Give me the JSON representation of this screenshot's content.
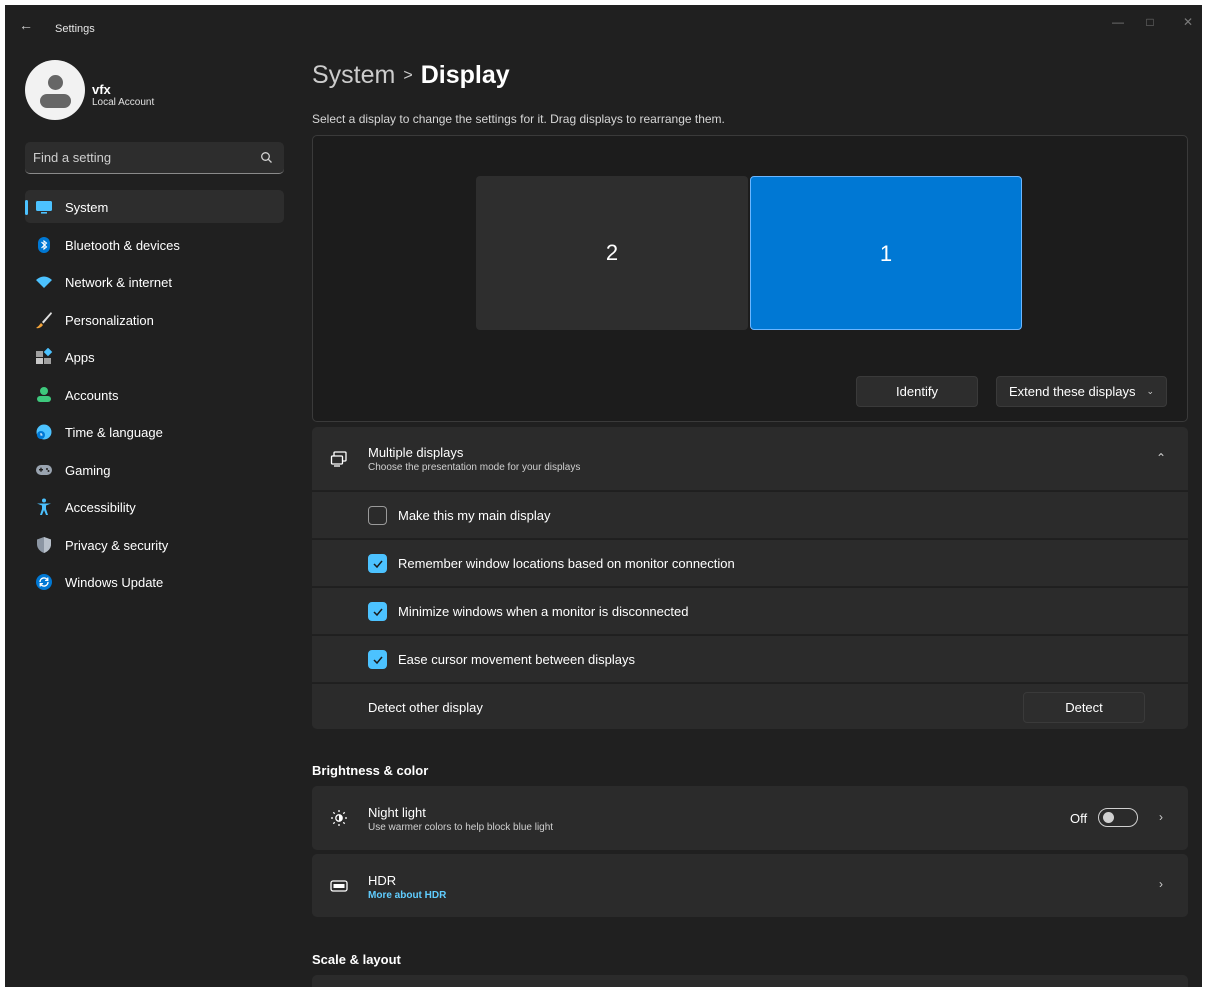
{
  "window": {
    "title": "Settings",
    "back_icon": "arrow-left-icon",
    "controls": [
      "minimize-icon",
      "maximize-icon",
      "close-icon"
    ]
  },
  "user": {
    "name": "vfx",
    "account_type": "Local Account"
  },
  "search": {
    "placeholder": "Find a setting",
    "value": ""
  },
  "sidebar": {
    "items": [
      {
        "label": "System",
        "icon": "monitor-icon",
        "selected": true
      },
      {
        "label": "Bluetooth & devices",
        "icon": "bluetooth-icon",
        "selected": false
      },
      {
        "label": "Network & internet",
        "icon": "wifi-icon",
        "selected": false
      },
      {
        "label": "Personalization",
        "icon": "brush-icon",
        "selected": false
      },
      {
        "label": "Apps",
        "icon": "apps-icon",
        "selected": false
      },
      {
        "label": "Accounts",
        "icon": "person-icon",
        "selected": false
      },
      {
        "label": "Time & language",
        "icon": "globe-clock-icon",
        "selected": false
      },
      {
        "label": "Gaming",
        "icon": "gamepad-icon",
        "selected": false
      },
      {
        "label": "Accessibility",
        "icon": "accessibility-icon",
        "selected": false
      },
      {
        "label": "Privacy & security",
        "icon": "shield-icon",
        "selected": false
      },
      {
        "label": "Windows Update",
        "icon": "refresh-icon",
        "selected": false
      }
    ]
  },
  "breadcrumb": {
    "parent": "System",
    "separator": ">",
    "current": "Display"
  },
  "display_arrangement": {
    "hint": "Select a display to change the settings for it. Drag displays to rearrange them.",
    "monitors": [
      {
        "number": "2",
        "selected": false
      },
      {
        "number": "1",
        "selected": true
      }
    ],
    "identify_label": "Identify",
    "extend_label": "Extend these displays"
  },
  "multiple_displays": {
    "title": "Multiple displays",
    "subtitle": "Choose the presentation mode for your displays",
    "expanded": true,
    "options": [
      {
        "label": "Make this my main display",
        "checked": false
      },
      {
        "label": "Remember window locations based on monitor connection",
        "checked": true
      },
      {
        "label": "Minimize windows when a monitor is disconnected",
        "checked": true
      },
      {
        "label": "Ease cursor movement between displays",
        "checked": true
      }
    ],
    "detect_label": "Detect other display",
    "detect_button": "Detect"
  },
  "brightness_color": {
    "section_title": "Brightness & color",
    "night_light": {
      "title": "Night light",
      "subtitle": "Use warmer colors to help block blue light",
      "state": "Off",
      "on": false
    },
    "hdr": {
      "title": "HDR",
      "link": "More about HDR"
    }
  },
  "scale_layout": {
    "section_title": "Scale & layout"
  },
  "colors": {
    "accent": "#0078d4",
    "accent_light": "#4cc2ff",
    "link": "#60cdff",
    "background": "#202020",
    "card": "#2b2b2b"
  }
}
